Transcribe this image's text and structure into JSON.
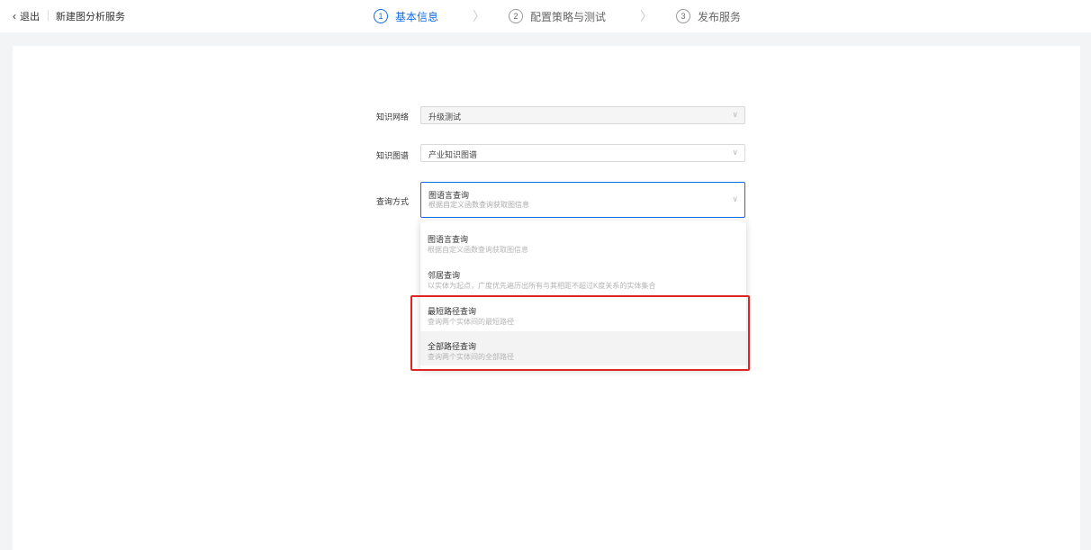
{
  "header": {
    "back_label": "退出",
    "title": "新建图分析服务"
  },
  "steps": [
    {
      "num": "1",
      "label": "基本信息",
      "active": true
    },
    {
      "num": "2",
      "label": "配置策略与测试",
      "active": false
    },
    {
      "num": "3",
      "label": "发布服务",
      "active": false
    }
  ],
  "form": {
    "network": {
      "label": "知识网络",
      "value": "升级测试",
      "disabled": true
    },
    "graph": {
      "label": "知识图谱",
      "value": "产业知识图谱"
    },
    "query": {
      "label": "查询方式",
      "value": "图语言查询",
      "desc": "根据自定义函数查询获取图信息"
    }
  },
  "dropdown": {
    "options": [
      {
        "title": "图语言查询",
        "desc": "根据自定义函数查询获取图信息"
      },
      {
        "title": "邻居查询",
        "desc": "以实体为起点，广度优先遍历出所有与其相距不超过K度关系的实体集合"
      },
      {
        "title": "最短路径查询",
        "desc": "查询两个实体间的最短路径"
      },
      {
        "title": "全部路径查询",
        "desc": "查询两个实体间的全部路径"
      }
    ]
  },
  "colors": {
    "accent": "#126ee3",
    "highlight": "#e02424"
  }
}
